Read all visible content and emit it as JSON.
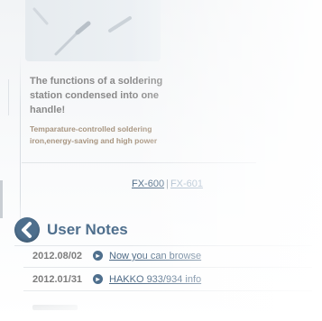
{
  "product": {
    "intro_lines": [
      "The functions of a soldering",
      "station condensed into one",
      "handle!"
    ],
    "feature_lines": [
      "Temparature-controlled soldering",
      "iron,energy-saving and high power"
    ],
    "image_icon": "soldering-iron-image"
  },
  "models": {
    "link_1": "FX-600",
    "separator": "|",
    "link_2": "FX-601"
  },
  "user_notes": {
    "back_icon": "chevron-left-icon",
    "title": "User Notes",
    "notes": [
      {
        "date": "2012.08/02",
        "link": "Now you can browse"
      },
      {
        "date": "2012.01/31",
        "link": "HAKKO 933/934 info"
      }
    ]
  },
  "colors": {
    "accent": "#4e6f8d",
    "intro_text": "#8a8a8a",
    "feature_text": "#a89580"
  }
}
